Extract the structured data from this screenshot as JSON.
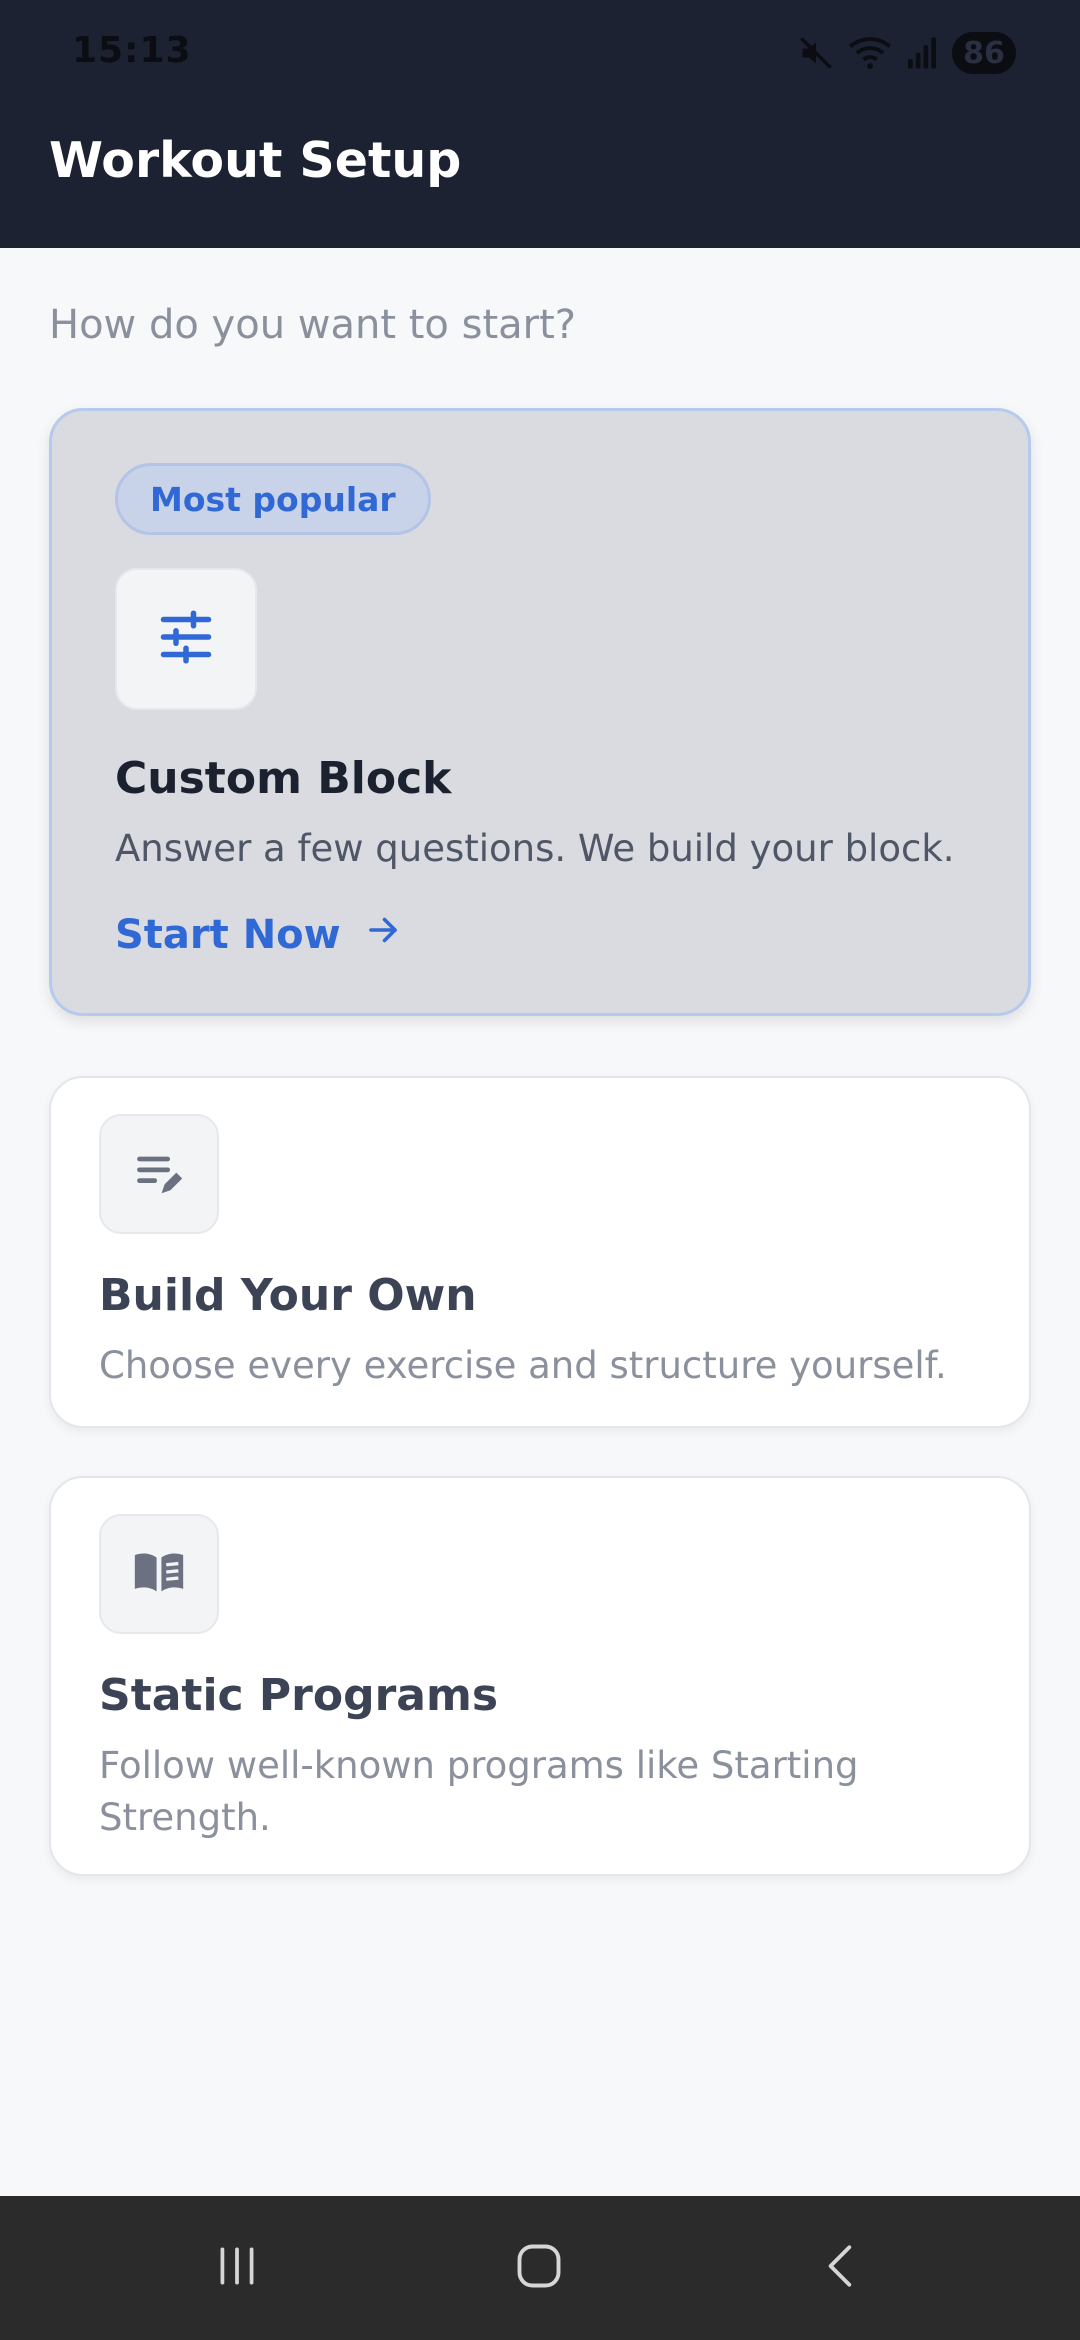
{
  "status_bar": {
    "time": "15:13",
    "battery": "86",
    "icons": [
      "mute-icon",
      "wifi-icon",
      "signal-icon",
      "battery-icon"
    ]
  },
  "header": {
    "title": "Workout Setup"
  },
  "main": {
    "prompt": "How do you want to start?",
    "options": [
      {
        "badge": "Most popular",
        "icon": "sliders-icon",
        "title": "Custom Block",
        "description": "Answer a few questions. We build your block.",
        "cta": "Start Now"
      },
      {
        "icon": "edit-list-icon",
        "title": "Build Your Own",
        "description": "Choose every exercise and structure yourself."
      },
      {
        "icon": "book-icon",
        "title": "Static Programs",
        "description": "Follow well-known programs like Starting Strength."
      }
    ]
  },
  "nav_bar": {
    "icons": [
      "recents-icon",
      "home-icon",
      "back-icon"
    ]
  },
  "colors": {
    "header_bg": "#1d2232",
    "accent": "#3068d6",
    "featured_card_bg": "#d9dbe1",
    "page_bg": "#f7f8fa"
  }
}
